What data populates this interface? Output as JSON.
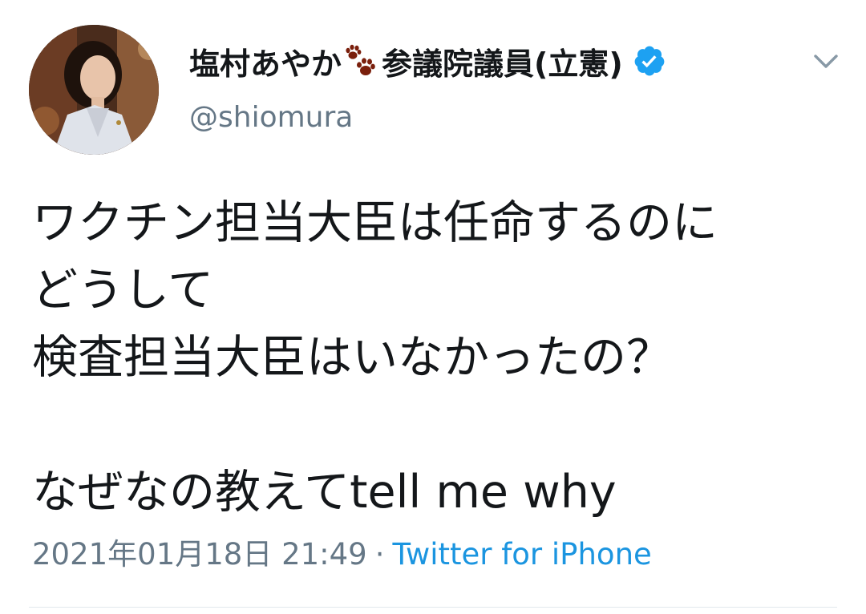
{
  "tweet": {
    "display_name_pre": "塩村あやか",
    "display_name_post": "参議院議員(立憲)",
    "handle": "@shiomura",
    "text": "ワクチン担当大臣は任命するのに\nどうして\n検査担当大臣はいなかったの？\n\nなぜなの教えてtell me why",
    "timestamp": "2021年01月18日 21:49",
    "separator": "·",
    "source": "Twitter for iPhone"
  },
  "icons": {
    "name_emoji": "paw-prints-icon",
    "verified": "verified-badge-icon",
    "menu": "chevron-down-icon"
  },
  "colors": {
    "text": "#14171a",
    "secondary": "#657786",
    "link": "#1b95e0",
    "verified": "#1da1f2",
    "paw": "#7a1f0c"
  }
}
